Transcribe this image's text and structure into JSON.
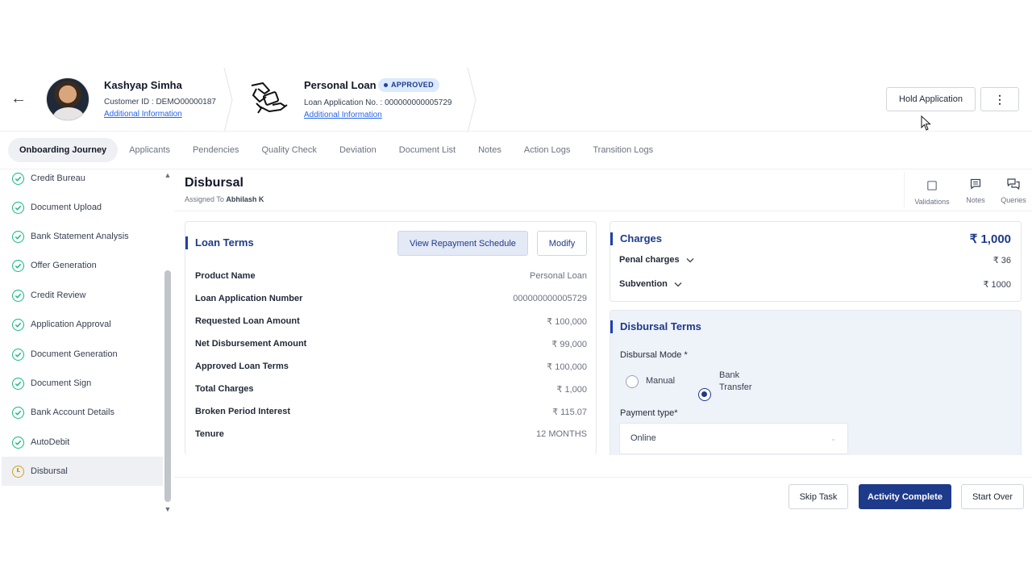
{
  "header": {
    "customer": {
      "name": "Kashyap Simha",
      "customer_id": "Customer ID : DEMO00000187",
      "info_link": "Additional Information"
    },
    "loan": {
      "title": "Personal Loan",
      "status": "APPROVED",
      "application_no": "Loan Application No. : 000000000005729",
      "info_link": "Additional Information"
    },
    "hold_label": "Hold Application",
    "more_label": "⋮"
  },
  "tabs": [
    {
      "label": "Onboarding Journey"
    },
    {
      "label": "Applicants"
    },
    {
      "label": "Pendencies"
    },
    {
      "label": "Quality Check"
    },
    {
      "label": "Deviation"
    },
    {
      "label": "Document List"
    },
    {
      "label": "Notes"
    },
    {
      "label": "Action Logs"
    },
    {
      "label": "Transition Logs"
    }
  ],
  "sidebar": {
    "items": [
      {
        "label": "Credit Bureau"
      },
      {
        "label": "Document Upload"
      },
      {
        "label": "Bank Statement Analysis"
      },
      {
        "label": "Offer Generation"
      },
      {
        "label": "Credit Review"
      },
      {
        "label": "Application Approval"
      },
      {
        "label": "Document Generation"
      },
      {
        "label": "Document Sign"
      },
      {
        "label": "Bank Account Details"
      },
      {
        "label": "AutoDebit"
      },
      {
        "label": "Disbursal"
      }
    ]
  },
  "main": {
    "title": "Disbursal",
    "assigned_prefix": "Assigned To",
    "assigned_to": "Abhilash K",
    "tools": [
      {
        "label": "Validations"
      },
      {
        "label": "Notes"
      },
      {
        "label": "Queries"
      }
    ]
  },
  "loan_terms": {
    "title": "Loan Terms",
    "repayment_btn": "View Repayment Schedule",
    "modify_btn": "Modify",
    "rows": [
      {
        "key": "Product Name",
        "value": "Personal Loan"
      },
      {
        "key": "Loan Application Number",
        "value": "000000000005729"
      },
      {
        "key": "Requested Loan Amount",
        "value": "₹ 100,000"
      },
      {
        "key": "Net Disbursement Amount",
        "value": "₹ 99,000"
      },
      {
        "key": "Approved Loan Terms",
        "value": "₹ 100,000"
      },
      {
        "key": "Total Charges",
        "value": "₹ 1,000"
      },
      {
        "key": "Broken Period Interest",
        "value": "₹ 115.07"
      },
      {
        "key": "Tenure",
        "value": "12 MONTHS"
      }
    ]
  },
  "charges": {
    "title": "Charges",
    "total": "₹ 1,000",
    "rows": [
      {
        "key": "Penal charges",
        "value": "₹ 36"
      },
      {
        "key": "Subvention",
        "value": "₹ 1000"
      }
    ]
  },
  "disbursal_terms": {
    "title": "Disbursal Terms",
    "mode_label": "Disbursal Mode *",
    "mode_options": [
      "Manual",
      "Bank Transfer"
    ],
    "mode_selected": "Bank Transfer",
    "payment_type_label": "Payment type*",
    "payment_type_value": "Online"
  },
  "footer": {
    "skip": "Skip Task",
    "complete": "Activity Complete",
    "start_over": "Start Over"
  },
  "colors": {
    "primary": "#1e3a8a",
    "success": "#10b981",
    "pending": "#d4a017",
    "badge_bg": "#dbeafe"
  }
}
